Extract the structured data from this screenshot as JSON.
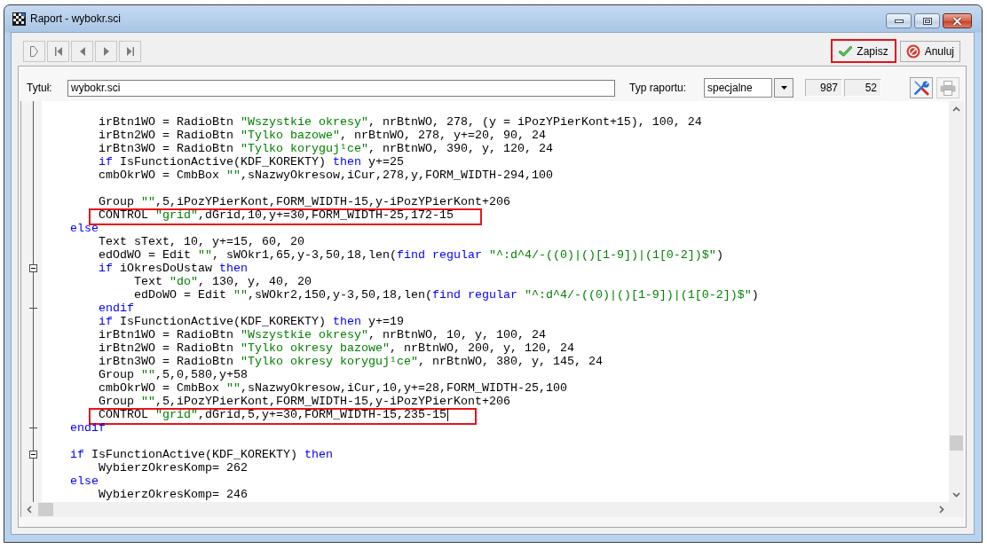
{
  "window": {
    "title": "Raport - wybokr.sci"
  },
  "actions": [
    {
      "kind": "save",
      "label": "Zapisz",
      "highlighted": true
    },
    {
      "kind": "cancel",
      "label": "Anuluj",
      "highlighted": false
    }
  ],
  "form": {
    "title_label": "Tytuł:",
    "title_value": "wybokr.sci",
    "type_label": "Typ raportu:",
    "type_value": "specjalne",
    "counters": [
      "987",
      "52"
    ],
    "tools": [
      {
        "kind": "tools",
        "disabled": false
      },
      {
        "kind": "print",
        "disabled": true
      }
    ]
  },
  "editor": {
    "blocks": [
      [
        {
          "kind": "plain",
          "tokens": [
            {
              "kind": "plain",
              "text": "        irBtn1WO = RadioBtn "
            },
            {
              "kind": "string",
              "text": "\"Wszystkie okresy\""
            },
            {
              "kind": "plain",
              "text": ", nrBtnWO, 278, (y = iPozYPierKont+15), 100, 24"
            }
          ],
          "highlighted": false,
          "caret": false
        },
        {
          "kind": "plain",
          "tokens": [
            {
              "kind": "plain",
              "text": "        irBtn2WO = RadioBtn "
            },
            {
              "kind": "string",
              "text": "\"Tylko bazowe\""
            },
            {
              "kind": "plain",
              "text": ", nrBtnWO, 278, y+=20, 90, 24"
            }
          ],
          "highlighted": false,
          "caret": false
        },
        {
          "kind": "plain",
          "tokens": [
            {
              "kind": "plain",
              "text": "        irBtn3WO = RadioBtn "
            },
            {
              "kind": "string",
              "text": "\"Tylko koryguj¹ce\""
            },
            {
              "kind": "plain",
              "text": ", nrBtnWO, 390, y, 120, 24"
            }
          ],
          "highlighted": false,
          "caret": false
        },
        {
          "kind": "plain",
          "tokens": [
            {
              "kind": "keyword",
              "text": "        if"
            },
            {
              "kind": "plain",
              "text": " IsFunctionActive(KDF_KOREKTY) "
            },
            {
              "kind": "keyword",
              "text": "then"
            },
            {
              "kind": "plain",
              "text": " y+=25"
            }
          ],
          "highlighted": false,
          "caret": false
        },
        {
          "kind": "plain",
          "tokens": [
            {
              "kind": "plain",
              "text": "        cmbOkrWO = CmbBox "
            },
            {
              "kind": "string",
              "text": "\"\""
            },
            {
              "kind": "plain",
              "text": ",sNazwyOkresow,iCur,278,y,FORM_WIDTH-294,100"
            }
          ],
          "highlighted": false,
          "caret": false
        }
      ],
      [
        {
          "kind": "plain",
          "tokens": [
            {
              "kind": "plain",
              "text": "        Group "
            },
            {
              "kind": "string",
              "text": "\"\""
            },
            {
              "kind": "plain",
              "text": ",5,iPozYPierKont,FORM_WIDTH-15,y-iPozYPierKont+206"
            }
          ],
          "highlighted": false,
          "caret": false
        },
        {
          "kind": "plain",
          "tokens": [
            {
              "kind": "plain",
              "text": "        CONTROL "
            },
            {
              "kind": "string",
              "text": "\"grid\""
            },
            {
              "kind": "plain",
              "text": ",dGrid,10,y+=30,FORM_WIDTH-25,172-15"
            }
          ],
          "highlighted": true,
          "caret": false
        },
        {
          "kind": "plain",
          "tokens": [
            {
              "kind": "keyword",
              "text": "    else"
            }
          ],
          "highlighted": false,
          "caret": false
        },
        {
          "kind": "plain",
          "tokens": [
            {
              "kind": "plain",
              "text": "        Text sText, 10, y+=15, 60, 20"
            }
          ],
          "highlighted": false,
          "caret": false
        },
        {
          "kind": "plain",
          "tokens": [
            {
              "kind": "plain",
              "text": "        edOdWO = Edit "
            },
            {
              "kind": "string",
              "text": "\"\""
            },
            {
              "kind": "plain",
              "text": ", sWOkr1,65,y-3,50,18,len("
            },
            {
              "kind": "keyword",
              "text": "find regular"
            },
            {
              "kind": "string",
              "text": " \"^:d^4/-((0)|()[1-9])|(1[0-2])$\""
            },
            {
              "kind": "plain",
              "text": ")"
            }
          ],
          "highlighted": false,
          "caret": false
        },
        {
          "kind": "foldstart",
          "tokens": [
            {
              "kind": "keyword",
              "text": "        if"
            },
            {
              "kind": "plain",
              "text": " iOkresDoUstaw "
            },
            {
              "kind": "keyword",
              "text": "then"
            }
          ],
          "highlighted": false,
          "caret": false
        },
        {
          "kind": "plain",
          "tokens": [
            {
              "kind": "plain",
              "text": "             Text "
            },
            {
              "kind": "string",
              "text": "\"do\""
            },
            {
              "kind": "plain",
              "text": ", 130, y, 40, 20"
            }
          ],
          "highlighted": false,
          "caret": false
        },
        {
          "kind": "plain",
          "tokens": [
            {
              "kind": "plain",
              "text": "             edDoWO = Edit "
            },
            {
              "kind": "string",
              "text": "\"\""
            },
            {
              "kind": "plain",
              "text": ",sWOkr2,150,y-3,50,18,len("
            },
            {
              "kind": "keyword",
              "text": "find regular"
            },
            {
              "kind": "string",
              "text": " \"^:d^4/-((0)|()[1-9])|(1[0-2])$\""
            },
            {
              "kind": "plain",
              "text": ")"
            }
          ],
          "highlighted": false,
          "caret": false
        },
        {
          "kind": "foldend",
          "tokens": [
            {
              "kind": "keyword",
              "text": "        endif"
            }
          ],
          "highlighted": false,
          "caret": false
        },
        {
          "kind": "plain",
          "tokens": [
            {
              "kind": "keyword",
              "text": "        if"
            },
            {
              "kind": "plain",
              "text": " IsFunctionActive(KDF_KOREKTY) "
            },
            {
              "kind": "keyword",
              "text": "then"
            },
            {
              "kind": "plain",
              "text": " y+=19"
            }
          ],
          "highlighted": false,
          "caret": false
        },
        {
          "kind": "plain",
          "tokens": [
            {
              "kind": "plain",
              "text": "        irBtn1WO = RadioBtn "
            },
            {
              "kind": "string",
              "text": "\"Wszystkie okresy\""
            },
            {
              "kind": "plain",
              "text": ", nrBtnWO, 10, y, 100, 24"
            }
          ],
          "highlighted": false,
          "caret": false
        },
        {
          "kind": "plain",
          "tokens": [
            {
              "kind": "plain",
              "text": "        irBtn2WO = RadioBtn "
            },
            {
              "kind": "string",
              "text": "\"Tylko okresy bazowe\""
            },
            {
              "kind": "plain",
              "text": ", nrBtnWO, 200, y, 120, 24"
            }
          ],
          "highlighted": false,
          "caret": false
        },
        {
          "kind": "plain",
          "tokens": [
            {
              "kind": "plain",
              "text": "        irBtn3WO = RadioBtn "
            },
            {
              "kind": "string",
              "text": "\"Tylko okresy koryguj¹ce\""
            },
            {
              "kind": "plain",
              "text": ", nrBtnWO, 380, y, 145, 24"
            }
          ],
          "highlighted": false,
          "caret": false
        },
        {
          "kind": "plain",
          "tokens": [
            {
              "kind": "plain",
              "text": "        Group "
            },
            {
              "kind": "string",
              "text": "\"\""
            },
            {
              "kind": "plain",
              "text": ",5,0,580,y+58"
            }
          ],
          "highlighted": false,
          "caret": false
        },
        {
          "kind": "plain",
          "tokens": [
            {
              "kind": "plain",
              "text": "        cmbOkrWO = CmbBox "
            },
            {
              "kind": "string",
              "text": "\"\""
            },
            {
              "kind": "plain",
              "text": ",sNazwyOkresow,iCur,10,y+=28,FORM_WIDTH-25,100"
            }
          ],
          "highlighted": false,
          "caret": false
        },
        {
          "kind": "plain",
          "tokens": [
            {
              "kind": "plain",
              "text": "        Group "
            },
            {
              "kind": "string",
              "text": "\"\""
            },
            {
              "kind": "plain",
              "text": ",5,iPozYPierKont,FORM_WIDTH-15,y-iPozYPierKont+206"
            }
          ],
          "highlighted": false,
          "caret": false
        },
        {
          "kind": "plain",
          "tokens": [
            {
              "kind": "plain",
              "text": "        CONTROL "
            },
            {
              "kind": "string",
              "text": "\"grid\""
            },
            {
              "kind": "plain",
              "text": ",dGrid,5,y+=30,FORM_WIDTH-15,235-15"
            }
          ],
          "highlighted": true,
          "caret": true
        },
        {
          "kind": "foldend",
          "tokens": [
            {
              "kind": "keyword",
              "text": "    endif"
            }
          ],
          "highlighted": false,
          "caret": false
        }
      ],
      [
        {
          "kind": "foldstart",
          "tokens": [
            {
              "kind": "keyword",
              "text": "    if"
            },
            {
              "kind": "plain",
              "text": " IsFunctionActive(KDF_KOREKTY) "
            },
            {
              "kind": "keyword",
              "text": "then"
            }
          ],
          "highlighted": false,
          "caret": false
        },
        {
          "kind": "plain",
          "tokens": [
            {
              "kind": "plain",
              "text": "        WybierzOkresKomp= 262"
            }
          ],
          "highlighted": false,
          "caret": false
        },
        {
          "kind": "plain",
          "tokens": [
            {
              "kind": "keyword",
              "text": "    else"
            }
          ],
          "highlighted": false,
          "caret": false
        },
        {
          "kind": "plain",
          "tokens": [
            {
              "kind": "plain",
              "text": "        WybierzOkresKomp= 246"
            }
          ],
          "highlighted": false,
          "caret": false
        }
      ]
    ]
  }
}
